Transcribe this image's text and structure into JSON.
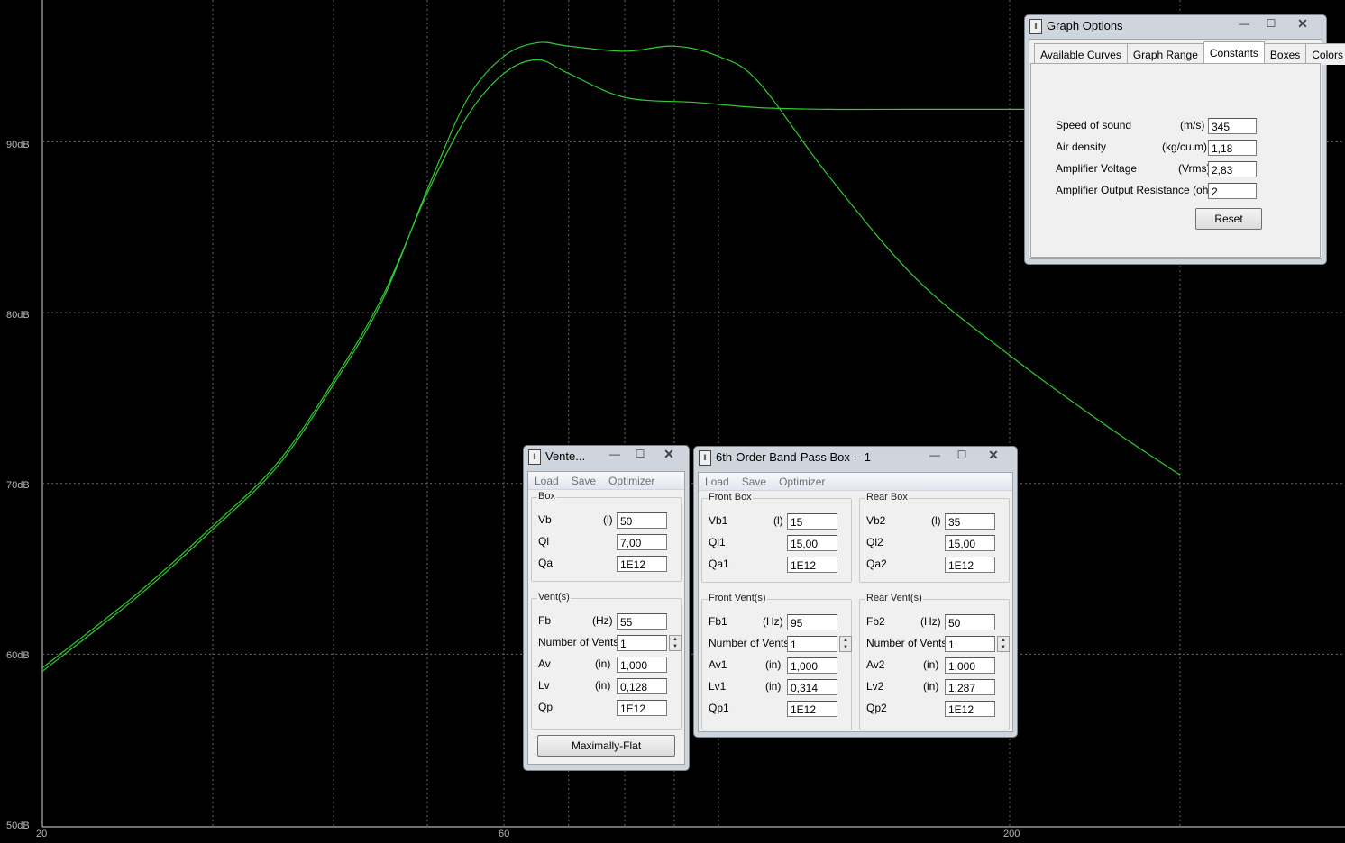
{
  "graph": {
    "y_axis_labels": [
      "90dB",
      "80dB",
      "70dB",
      "60dB",
      "50dB"
    ],
    "x_axis_labels": [
      "20",
      "60",
      "200"
    ],
    "ylim_db": [
      50,
      90
    ],
    "grid_color": "#6a6a6a",
    "curve_color": "#2ecc2e",
    "curves": [
      {
        "points": [
          [
            20,
            59.2
          ],
          [
            25,
            63.5
          ],
          [
            30,
            67.5
          ],
          [
            35,
            71.2
          ],
          [
            40,
            76.0
          ],
          [
            45,
            81.0
          ],
          [
            50,
            87.0
          ],
          [
            55,
            91.5
          ],
          [
            60,
            94.0
          ],
          [
            65,
            94.8
          ],
          [
            70,
            94.0
          ],
          [
            80,
            92.6
          ],
          [
            95,
            92.3
          ],
          [
            110,
            92.0
          ],
          [
            130,
            91.9
          ],
          [
            160,
            91.9
          ],
          [
            200,
            91.9
          ],
          [
            300,
            91.9
          ]
        ]
      },
      {
        "points": [
          [
            20,
            59.0
          ],
          [
            25,
            63.3
          ],
          [
            30,
            67.3
          ],
          [
            35,
            71.0
          ],
          [
            40,
            75.8
          ],
          [
            45,
            80.8
          ],
          [
            50,
            87.2
          ],
          [
            55,
            92.5
          ],
          [
            60,
            95.0
          ],
          [
            65,
            95.8
          ],
          [
            70,
            95.6
          ],
          [
            80,
            95.3
          ],
          [
            90,
            95.6
          ],
          [
            100,
            95.0
          ],
          [
            110,
            93.5
          ],
          [
            130,
            88.0
          ],
          [
            160,
            82.0
          ],
          [
            200,
            77.5
          ],
          [
            250,
            73.5
          ],
          [
            300,
            70.5
          ]
        ]
      }
    ]
  },
  "graph_options": {
    "title": "Graph Options",
    "tabs": [
      "Available Curves",
      "Graph Range",
      "Constants",
      "Boxes",
      "Colors"
    ],
    "active_tab": "Constants",
    "rows": [
      {
        "label": "Speed of sound",
        "unit": "(m/s)",
        "value": "345"
      },
      {
        "label": "Air density",
        "unit": "(kg/cu.m)",
        "value": "1,18"
      },
      {
        "label": "Amplifier Voltage",
        "unit": "(Vrms)",
        "value": "2,83"
      },
      {
        "label": "Amplifier Output Resistance (ohms)",
        "unit": "",
        "value": "2"
      }
    ],
    "reset_label": "Reset"
  },
  "vented": {
    "title": "Vente...",
    "menu": [
      "Load",
      "Save",
      "Optimizer"
    ],
    "box_label": "Box",
    "box_rows": [
      {
        "label": "Vb",
        "unit": "(l)",
        "value": "50"
      },
      {
        "label": "Ql",
        "unit": "",
        "value": "7,00"
      },
      {
        "label": "Qa",
        "unit": "",
        "value": "1E12"
      }
    ],
    "vents_label": "Vent(s)",
    "vent_rows": [
      {
        "label": "Fb",
        "unit": "(Hz)",
        "value": "55"
      },
      {
        "label": "Number of Vents",
        "unit": "",
        "value": "1"
      },
      {
        "label": "Av",
        "unit": "(in)",
        "value": "1,000"
      },
      {
        "label": "Lv",
        "unit": "(in)",
        "value": "0,128"
      },
      {
        "label": "Qp",
        "unit": "",
        "value": "1E12"
      }
    ],
    "button_label": "Maximally-Flat"
  },
  "bandpass": {
    "title": "6th-Order Band-Pass Box -- 1",
    "menu": [
      "Load",
      "Save",
      "Optimizer"
    ],
    "front_box_label": "Front Box",
    "front_box_rows": [
      {
        "label": "Vb1",
        "unit": "(l)",
        "value": "15"
      },
      {
        "label": "Ql1",
        "unit": "",
        "value": "15,00"
      },
      {
        "label": "Qa1",
        "unit": "",
        "value": "1E12"
      }
    ],
    "rear_box_label": "Rear Box",
    "rear_box_rows": [
      {
        "label": "Vb2",
        "unit": "(l)",
        "value": "35"
      },
      {
        "label": "Ql2",
        "unit": "",
        "value": "15,00"
      },
      {
        "label": "Qa2",
        "unit": "",
        "value": "1E12"
      }
    ],
    "front_vents_label": "Front Vent(s)",
    "front_vent_rows": [
      {
        "label": "Fb1",
        "unit": "(Hz)",
        "value": "95"
      },
      {
        "label": "Number of Vents",
        "unit": "",
        "value": "1"
      },
      {
        "label": "Av1",
        "unit": "(in)",
        "value": "1,000"
      },
      {
        "label": "Lv1",
        "unit": "(in)",
        "value": "0,314"
      },
      {
        "label": "Qp1",
        "unit": "",
        "value": "1E12"
      }
    ],
    "rear_vents_label": "Rear Vent(s)",
    "rear_vent_rows": [
      {
        "label": "Fb2",
        "unit": "(Hz)",
        "value": "50"
      },
      {
        "label": "Number of Vents",
        "unit": "",
        "value": "1"
      },
      {
        "label": "Av2",
        "unit": "(in)",
        "value": "1,000"
      },
      {
        "label": "Lv2",
        "unit": "(in)",
        "value": "1,287"
      },
      {
        "label": "Qp2",
        "unit": "",
        "value": "1E12"
      }
    ]
  }
}
